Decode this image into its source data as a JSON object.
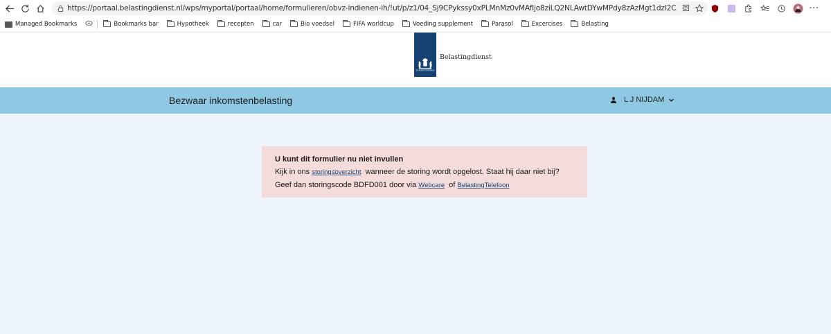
{
  "browser": {
    "url": "https://portaal.belastingdienst.nl/wps/myportal/portaal/home/formulieren/obvz-indienen-ih/!ut/p/z1/04_Sj9CPykssy0xPLMnMz0vMAfIjo8ziLQ2NLAwtDYwMPdy8zAzMgt1dzI2CAg0NjAz0wwkpiAJKG-AAjiD9UViUOBo4BRk5..."
  },
  "bookmarks": [
    {
      "label": "Managed Bookmarks",
      "icon": "managed-folder-icon"
    },
    {
      "label": "Bookmarks bar",
      "icon": "folder-icon"
    },
    {
      "label": "Hypotheek",
      "icon": "folder-icon"
    },
    {
      "label": "recepten",
      "icon": "folder-icon"
    },
    {
      "label": "car",
      "icon": "folder-icon"
    },
    {
      "label": "Bio voedsel",
      "icon": "folder-icon"
    },
    {
      "label": "FIFA worldcup",
      "icon": "folder-icon"
    },
    {
      "label": "Voeding supplement",
      "icon": "folder-icon"
    },
    {
      "label": "Parasol",
      "icon": "folder-icon"
    },
    {
      "label": "Excercises",
      "icon": "folder-icon"
    },
    {
      "label": "Belasting",
      "icon": "folder-icon"
    }
  ],
  "site": {
    "logo_text": "Belastingdienst",
    "brand_color": "#154273",
    "bar_color": "#8fc8e3"
  },
  "header": {
    "title": "Bezwaar inkomstenbelasting",
    "user_name": "L J NIJDAM"
  },
  "alert": {
    "heading": "U kunt dit formulier nu niet invullen",
    "text_1": "Kijk in ons",
    "link_1": "storingsoverzicht",
    "text_2": "wanneer de storing wordt opgelost. Staat hij daar niet bij? Geef dan storingscode BDFD001 door via",
    "link_2": "Webcare",
    "text_3": "of",
    "link_3": "BelastingTelefoon",
    "background": "#f4dcdb"
  }
}
